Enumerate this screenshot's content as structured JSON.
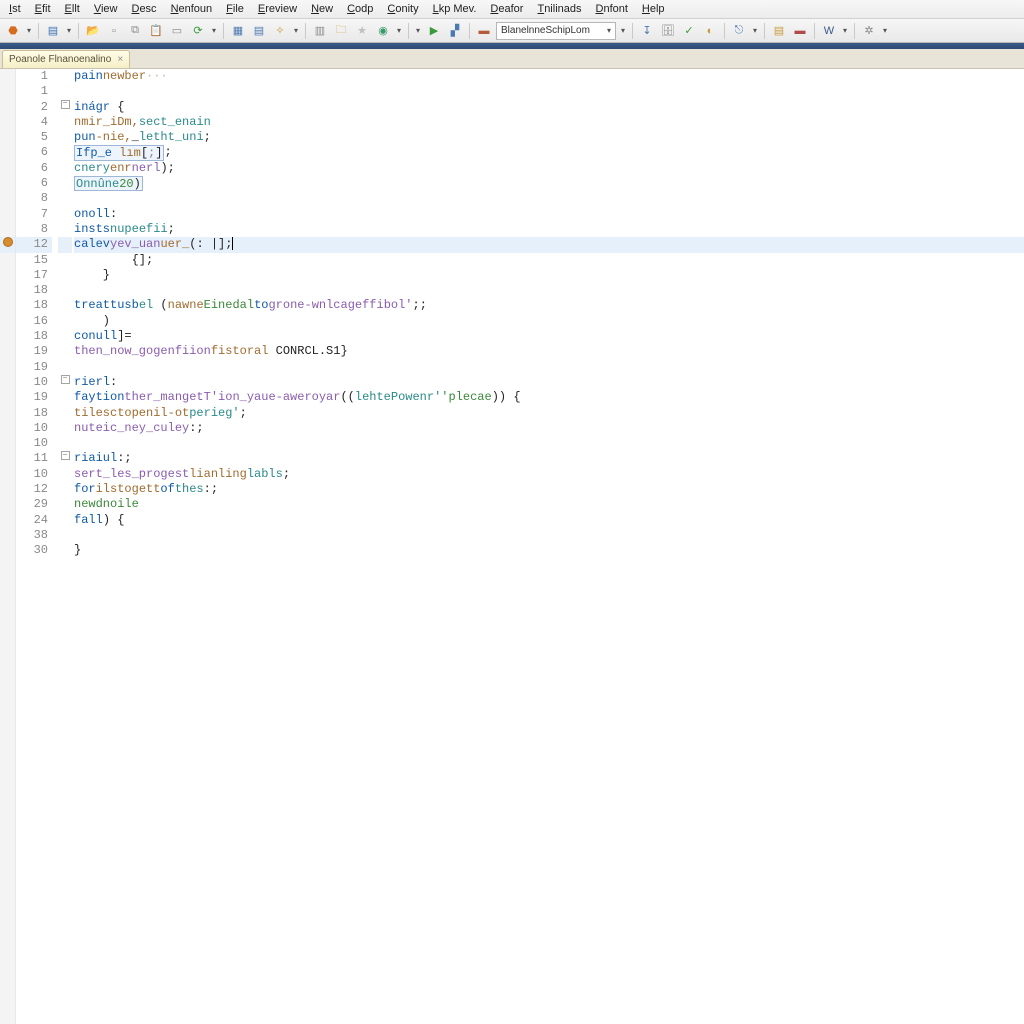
{
  "menubar": [
    "Ist",
    "Efit",
    "Ellt",
    "View",
    "Desc",
    "Nenfoun",
    "File",
    "Ereview",
    "New",
    "Codp",
    "Conity",
    "Lkp Mev.",
    "Deafor",
    "Tnilinads",
    "Dnfont",
    "Help"
  ],
  "toolbar": {
    "combo": "BlanelnneSchipLom"
  },
  "filetab": "Poanole Flnanoenalino",
  "code_lines": [
    {
      "n": "1",
      "cur": false,
      "fold": "",
      "bp": "",
      "html": "<span class='kw'>pain</span> <span class='id2'>newber</span> <span style='color:#bbb'>···</span>"
    },
    {
      "n": "1",
      "cur": false,
      "fold": "",
      "bp": "",
      "html": ""
    },
    {
      "n": "2",
      "cur": false,
      "fold": "-",
      "bp": "",
      "html": "<span class='kw'>inágr</span> {"
    },
    {
      "n": "4",
      "cur": false,
      "fold": "",
      "bp": "",
      "html": "    <span class='id2'>nmir_iDm,</span> <span class='type'>sect_enain</span>"
    },
    {
      "n": "5",
      "cur": false,
      "fold": "",
      "bp": "",
      "html": "    <span class='kw'>pun</span> <span class='id2'>-nie,</span>_<span class='type'>letht_uni</span>;"
    },
    {
      "n": "6",
      "cur": false,
      "fold": "",
      "bp": "",
      "html": "    <span class='box'><span class='kw'>Ifp_e</span> <span class='id2'>lım</span>[<span style='color:#888'>;</span>]</span>;"
    },
    {
      "n": "6",
      "cur": false,
      "fold": "",
      "bp": "",
      "html": "    <span class='type'>cnery</span> <span class='id2'>enr</span> <span class='fn'>nerl</span>);"
    },
    {
      "n": "6",
      "cur": false,
      "fold": "",
      "bp": "",
      "html": "    <span class='box'><span class='type'>Onnûne</span><span class='num'>20</span>)</span>"
    },
    {
      "n": "8",
      "cur": false,
      "fold": "",
      "bp": "",
      "html": ""
    },
    {
      "n": "7",
      "cur": false,
      "fold": "",
      "bp": "",
      "html": "    <span class='kw'>onoll</span>:"
    },
    {
      "n": "8",
      "cur": false,
      "fold": "",
      "bp": "",
      "html": "     <span class='kw'>insts</span> <span class='type'>nupeefii</span>;"
    },
    {
      "n": "12",
      "cur": true,
      "fold": "",
      "bp": "y",
      "html": "        <span class='kw'>calev</span> <span class='fn'>yev_uan</span> <span class='id2'>uer_</span>(: |];<span class='caret'></span>"
    },
    {
      "n": "15",
      "cur": false,
      "fold": "",
      "bp": "",
      "html": "        {];"
    },
    {
      "n": "17",
      "cur": false,
      "fold": "",
      "bp": "",
      "html": "    }"
    },
    {
      "n": "18",
      "cur": false,
      "fold": "",
      "bp": "",
      "html": ""
    },
    {
      "n": "18",
      "cur": false,
      "fold": "",
      "bp": "",
      "html": "    <span class='kw'>treat</span> <span class='kw'>tusb</span> <span class='type'>el</span> (<span class='id2'>nawne</span> <span class='str'>Einedal</span> <span class='kw'>to</span> <span class='fn'>grone-wnlcageffibol'</span>;;"
    },
    {
      "n": "16",
      "cur": false,
      "fold": "",
      "bp": "",
      "html": "    )"
    },
    {
      "n": "18",
      "cur": false,
      "fold": "",
      "bp": "",
      "html": "    <span class='kw'>conull</span>]="
    },
    {
      "n": "19",
      "cur": false,
      "fold": "",
      "bp": "",
      "html": "         <span class='fn'>then_now_gogenfiion</span> <span class='id2'>fistoral</span> CONRCL.S1}"
    },
    {
      "n": "19",
      "cur": false,
      "fold": "",
      "bp": "",
      "html": ""
    },
    {
      "n": "10",
      "cur": false,
      "fold": "-",
      "bp": "",
      "html": "     <span class='kw'>rierl</span>:"
    },
    {
      "n": "19",
      "cur": false,
      "fold": "",
      "bp": "",
      "html": "       <span class='kw'>faytion</span> <span class='fn'>ther_mangetT'ion_yaue-aweroyar</span>((<span class='type'>lehtePowenr'</span><span class='str'>'plecae</span>)) {"
    },
    {
      "n": "18",
      "cur": false,
      "fold": "",
      "bp": "",
      "html": "       <span class='id2'>tilesctopenil-ot</span> <span class='type'>perieg'</span>;"
    },
    {
      "n": "10",
      "cur": false,
      "fold": "",
      "bp": "",
      "html": "       <span class='fn'>nuteic_ney_culey</span>:;"
    },
    {
      "n": "10",
      "cur": false,
      "fold": "",
      "bp": "",
      "html": ""
    },
    {
      "n": "11",
      "cur": false,
      "fold": "-",
      "bp": "",
      "html": "     <span class='kw'>riaiul</span>:;"
    },
    {
      "n": "10",
      "cur": false,
      "fold": "",
      "bp": "",
      "html": "     <span class='fn'>sert_les_progest</span> <span class='id2'>lianling</span> <span class='type'>labls</span>;"
    },
    {
      "n": "12",
      "cur": false,
      "fold": "",
      "bp": "",
      "html": "       <span class='kw'>for</span> <span class='id2'>ilstogett</span> <span class='kw'>of</span> <span class='type'>thes</span>:;"
    },
    {
      "n": "29",
      "cur": false,
      "fold": "",
      "bp": "",
      "html": "        <span class='cmt'>newdnoile</span>"
    },
    {
      "n": "24",
      "cur": false,
      "fold": "",
      "bp": "",
      "html": "   <span class='kw'>fall</span>) {"
    },
    {
      "n": "38",
      "cur": false,
      "fold": "",
      "bp": "",
      "html": ""
    },
    {
      "n": "30",
      "cur": false,
      "fold": "",
      "bp": "",
      "html": "}"
    }
  ],
  "toolbar_icons": [
    {
      "name": "stop-icon",
      "glyph": "⬣",
      "color": "#d66c1e"
    },
    {
      "name": "dd",
      "glyph": "▾"
    },
    {
      "name": "sep"
    },
    {
      "name": "save-icon",
      "glyph": "▤",
      "color": "#3a72b5"
    },
    {
      "name": "dd",
      "glyph": "▾"
    },
    {
      "name": "sep"
    },
    {
      "name": "open-icon",
      "glyph": "📂",
      "color": "#caa24a"
    },
    {
      "name": "new-icon",
      "glyph": "▫",
      "color": "#888"
    },
    {
      "name": "copy-icon",
      "glyph": "⧉",
      "color": "#888"
    },
    {
      "name": "paste-icon",
      "glyph": "📋",
      "color": "#888"
    },
    {
      "name": "doc-icon",
      "glyph": "▭",
      "color": "#888"
    },
    {
      "name": "refresh-icon",
      "glyph": "⟳",
      "color": "#3a9a3a"
    },
    {
      "name": "dd",
      "glyph": "▾"
    },
    {
      "name": "sep"
    },
    {
      "name": "grid-icon",
      "glyph": "▦",
      "color": "#4a78b0"
    },
    {
      "name": "table-icon",
      "glyph": "▤",
      "color": "#4a78b0"
    },
    {
      "name": "wand-icon",
      "glyph": "✧",
      "color": "#c79a3a"
    },
    {
      "name": "dd",
      "glyph": "▾"
    },
    {
      "name": "sep"
    },
    {
      "name": "layout-icon",
      "glyph": "▥",
      "color": "#888"
    },
    {
      "name": "folder-icon",
      "glyph": "🗀",
      "color": "#caa24a"
    },
    {
      "name": "star-icon",
      "glyph": "★",
      "color": "#bfbfbf"
    },
    {
      "name": "globe-icon",
      "glyph": "◉",
      "color": "#3a9a6a"
    },
    {
      "name": "dd",
      "glyph": "▾"
    },
    {
      "name": "sep"
    },
    {
      "name": "dd",
      "glyph": "▾"
    },
    {
      "name": "flag-icon",
      "glyph": "▶",
      "color": "#3a9a3a"
    },
    {
      "name": "chart-icon",
      "glyph": "▞",
      "color": "#4a78b0"
    },
    {
      "name": "sep"
    },
    {
      "name": "brick-icon",
      "glyph": "▬",
      "color": "#b55a3a"
    },
    {
      "name": "combo"
    },
    {
      "name": "dd",
      "glyph": "▾"
    },
    {
      "name": "sep"
    },
    {
      "name": "step-icon",
      "glyph": "↧",
      "color": "#4a78b0"
    },
    {
      "name": "db-icon",
      "glyph": "🗄",
      "color": "#888"
    },
    {
      "name": "check-icon",
      "glyph": "✓",
      "color": "#3a9a3a"
    },
    {
      "name": "help-icon",
      "glyph": "◐",
      "color": "#c79a3a"
    },
    {
      "name": "sep"
    },
    {
      "name": "link-icon",
      "glyph": "⎋",
      "color": "#4a78b0"
    },
    {
      "name": "dd",
      "glyph": "▾"
    },
    {
      "name": "sep"
    },
    {
      "name": "save2-icon",
      "glyph": "▤",
      "color": "#c79a3a"
    },
    {
      "name": "close-icon",
      "glyph": "▬",
      "color": "#b04a4a"
    },
    {
      "name": "sep"
    },
    {
      "name": "w-icon",
      "glyph": "W",
      "color": "#3a5b8a"
    },
    {
      "name": "dd",
      "glyph": "▾"
    },
    {
      "name": "sep"
    },
    {
      "name": "gear-icon",
      "glyph": "✲",
      "color": "#888"
    },
    {
      "name": "dd",
      "glyph": "▾"
    }
  ]
}
